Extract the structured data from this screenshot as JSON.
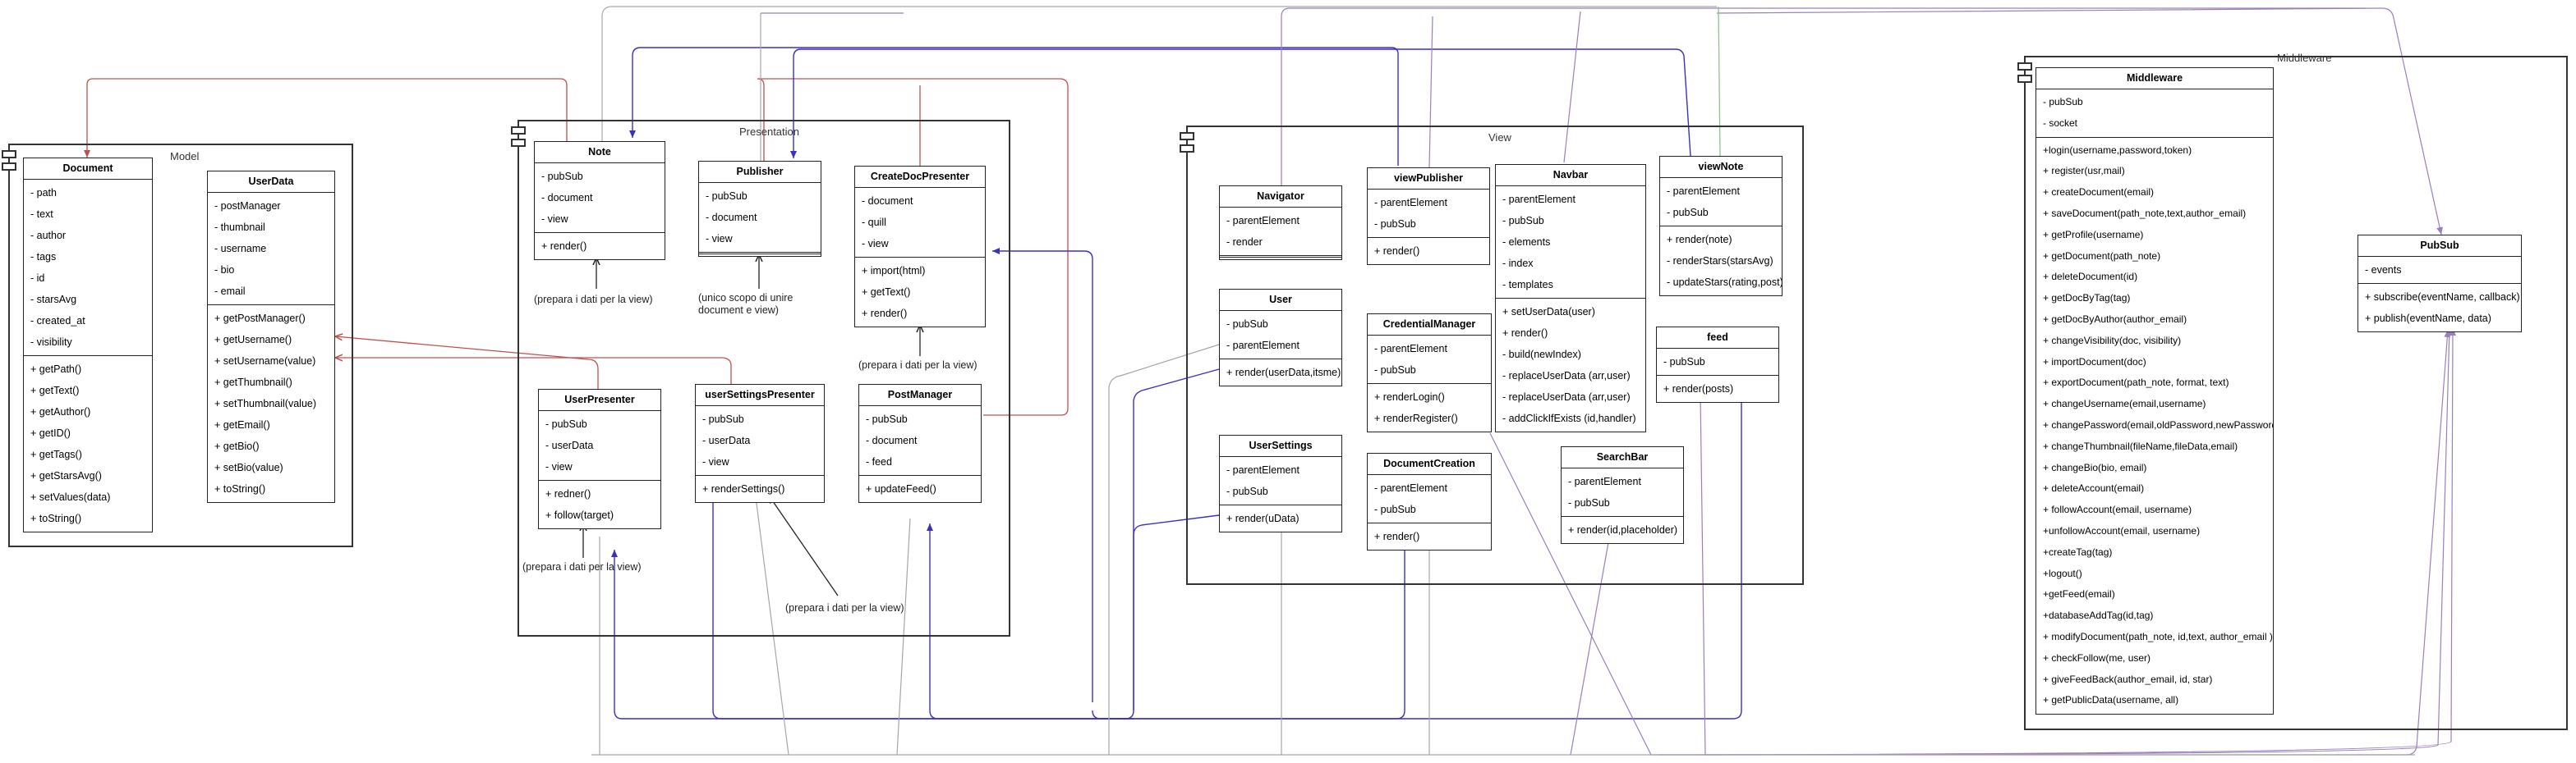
{
  "packages": {
    "model": "Model",
    "presentation": "Presentation",
    "view": "View",
    "middleware": "Middleware"
  },
  "classes": {
    "document": {
      "name": "Document",
      "attributes": [
        "- path",
        "- text",
        "- author",
        "- tags",
        "- id",
        "- starsAvg",
        "- created_at",
        "- visibility"
      ],
      "methods": [
        "+ getPath()",
        "+ getText()",
        "+ getAuthor()",
        "+ getID()",
        "+ getTags()",
        "+ getStarsAvg()",
        "+ setValues(data)",
        "+ toString()"
      ]
    },
    "userdata": {
      "name": "UserData",
      "attributes": [
        "- postManager",
        "- thumbnail",
        "- username",
        "- bio",
        "- email"
      ],
      "methods": [
        "+ getPostManager()",
        "+ getUsername()",
        "+ setUsername(value)",
        "+ getThumbnail()",
        "+ setThumbnail(value)",
        "+ getEmail()",
        "+ getBio()",
        "+ setBio(value)",
        "+ toString()"
      ]
    },
    "note": {
      "name": "Note",
      "attributes": [
        "- pubSub",
        "- document",
        "- view"
      ],
      "methods": [
        "+ render()"
      ]
    },
    "publisher": {
      "name": "Publisher",
      "attributes": [
        "- pubSub",
        "- document",
        "- view"
      ],
      "methods": []
    },
    "createdocpresenter": {
      "name": "CreateDocPresenter",
      "attributes": [
        "- document",
        "- quill",
        "- view"
      ],
      "methods": [
        "+ import(html)",
        "+ getText()",
        "+ render()"
      ]
    },
    "userpresenter": {
      "name": "UserPresenter",
      "attributes": [
        "- pubSub",
        "- userData",
        "- view"
      ],
      "methods": [
        "+ redner()",
        "+ follow(target)"
      ]
    },
    "usersettingspresenter": {
      "name": "userSettingsPresenter",
      "attributes": [
        "- pubSub",
        "- userData",
        "- view"
      ],
      "methods": [
        "+ renderSettings()"
      ]
    },
    "postmanager": {
      "name": "PostManager",
      "attributes": [
        "- pubSub",
        "- document",
        "- feed"
      ],
      "methods": [
        "+ updateFeed()"
      ]
    },
    "navigator": {
      "name": "Navigator",
      "attributes": [
        "- parentElement",
        "- render"
      ],
      "methods": []
    },
    "viewpublisher": {
      "name": "viewPublisher",
      "attributes": [
        "- parentElement",
        "- pubSub"
      ],
      "methods": [
        "+ render()"
      ]
    },
    "navbar": {
      "name": "Navbar",
      "attributes": [
        "- parentElement",
        "- pubSub",
        "- elements",
        "- index",
        "- templates"
      ],
      "methods": [
        "+ setUserData(user)",
        "+ render()",
        "- build(newIndex)",
        "- replaceUserData (arr,user)",
        "- replaceUserData (arr,user)",
        "- addClickIfExists (id,handler)"
      ]
    },
    "viewnote": {
      "name": "viewNote",
      "attributes": [
        "- parentElement",
        "- pubSub"
      ],
      "methods": [
        "+ render(note)",
        "- renderStars(starsAvg)",
        "- updateStars(rating,post)"
      ]
    },
    "user": {
      "name": "User",
      "attributes": [
        "- pubSub",
        "- parentElement"
      ],
      "methods": [
        "+ render(userData,itsme)"
      ]
    },
    "credentialmanager": {
      "name": "CredentialManager",
      "attributes": [
        "- parentElement",
        "- pubSub"
      ],
      "methods": [
        "+ renderLogin()",
        "+ renderRegister()"
      ]
    },
    "feed": {
      "name": "feed",
      "attributes": [
        "- pubSub"
      ],
      "methods": [
        "+ render(posts)"
      ]
    },
    "usersettings": {
      "name": "UserSettings",
      "attributes": [
        "- parentElement",
        "- pubSub"
      ],
      "methods": [
        "+ render(uData)"
      ]
    },
    "documentcreation": {
      "name": "DocumentCreation",
      "attributes": [
        "- parentElement",
        "- pubSub"
      ],
      "methods": [
        "+ render()"
      ]
    },
    "searchbar": {
      "name": "SearchBar",
      "attributes": [
        "- parentElement",
        "- pubSub"
      ],
      "methods": [
        "+ render(id,placeholder)"
      ]
    },
    "middleware": {
      "name": "Middleware",
      "attributes": [
        "- pubSub",
        "- socket"
      ],
      "methods": [
        "+login(username,password,token)",
        "+ register(usr,mail)",
        "+ createDocument(email)",
        "+ saveDocument(path_note,text,author_email)",
        "+ getProfile(username)",
        "+ getDocument(path_note)",
        "+ deleteDocument(id)",
        "+ getDocByTag(tag)",
        "+ getDocByAuthor(author_email)",
        "+ changeVisibility(doc, visibility)",
        "+ importDocument(doc)",
        "+ exportDocument(path_note, format, text)",
        "+ changeUsername(email,username)",
        "+ changePassword(email,oldPassword,newPassword)",
        "+ changeThumbnail(fileName,fileData,email)",
        "+ changeBio(bio, email)",
        "+ deleteAccount(email)",
        "+ followAccount(email, username)",
        "+unfollowAccount(email, username)",
        "+createTag(tag)",
        "+logout()",
        "+getFeed(email)",
        "+databaseAddTag(id,tag)",
        "+ modifyDocument(path_note, id,text, author_email )",
        "+ checkFollow(me, user)",
        "+ giveFeedBack(author_email, id, star)",
        "+ getPublicData(username, all)"
      ]
    },
    "pubsub": {
      "name": "PubSub",
      "attributes": [
        "- events"
      ],
      "methods": [
        "+ subscribe(eventName, callback)",
        "+ publish(eventName, data)"
      ]
    }
  },
  "notes": {
    "note": "(prepara i dati per la view)",
    "publisher": "(unico scopo di unire\ndocument e view)",
    "createdoc": "(prepara i dati per la view)",
    "userpresenter": "(prepara i dati per la view)",
    "usersettings": "(prepara i dati per la view)"
  },
  "colors": {
    "dependency_red": "#c0504d",
    "blue": "#3b2fc9",
    "purple": "#9a7fbe",
    "gray": "#a6a6a6",
    "green": "#8dc58a"
  }
}
